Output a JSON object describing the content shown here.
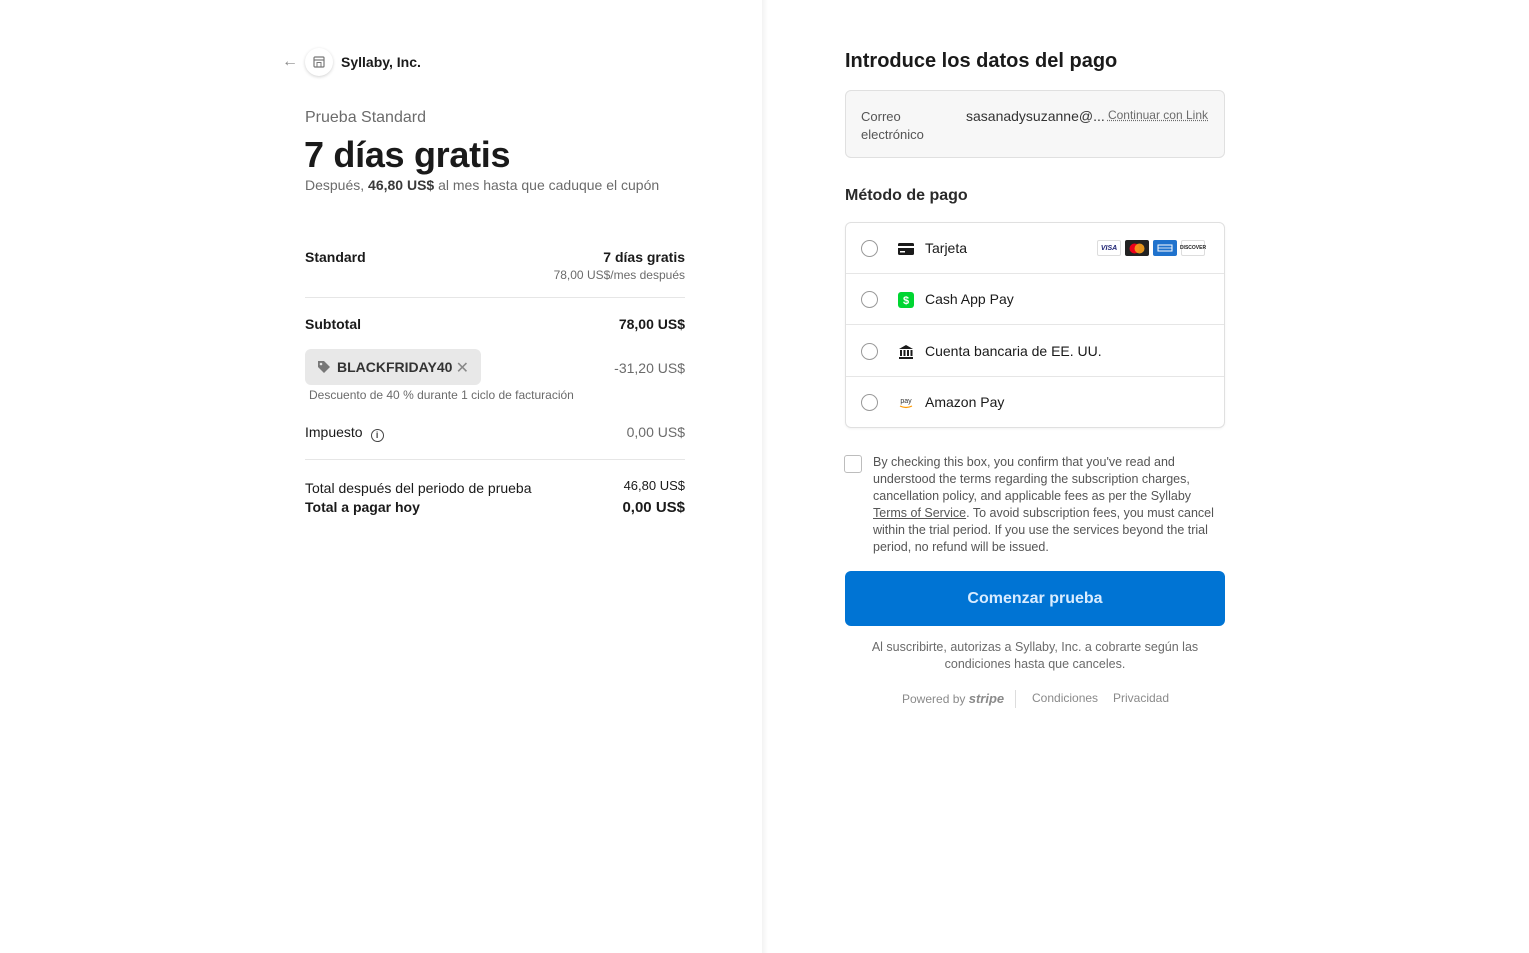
{
  "merchant": {
    "name": "Syllaby, Inc."
  },
  "summary": {
    "product_name": "Prueba Standard",
    "headline": "7 días gratis",
    "subline_prefix": "Después, ",
    "subline_amount": "46,80 US$",
    "subline_suffix": " al mes hasta que caduque el cupón"
  },
  "line_item": {
    "name": "Standard",
    "price": "7 días gratis",
    "price_after": "78,00 US$/mes después"
  },
  "subtotal": {
    "label": "Subtotal",
    "value": "78,00 US$"
  },
  "coupon": {
    "code": "BLACKFRIDAY40",
    "discount": "-31,20 US$",
    "description": "Descuento de 40 % durante 1 ciclo de facturación"
  },
  "tax": {
    "label": "Impuesto",
    "value": "0,00 US$"
  },
  "total_after_trial": {
    "label": "Total después del periodo de prueba",
    "value": "46,80 US$"
  },
  "total_today": {
    "label": "Total a pagar hoy",
    "value": "0,00 US$"
  },
  "payment": {
    "title": "Introduce los datos del pago",
    "email_label": "Correo electrónico",
    "email_value": "sasanadysuzanne@...",
    "link_button": "Continuar con Link",
    "method_title": "Método de pago",
    "methods": [
      {
        "label": "Tarjeta",
        "icon": "card-icon"
      },
      {
        "label": "Cash App Pay",
        "icon": "cash-app-icon"
      },
      {
        "label": "Cuenta bancaria de EE. UU.",
        "icon": "bank-icon"
      },
      {
        "label": "Amazon Pay",
        "icon": "amazon-pay-icon"
      }
    ],
    "card_brands": [
      "VISA",
      "Mastercard",
      "AMEX",
      "DISCOVER"
    ]
  },
  "terms": {
    "text_before": "By checking this box, you confirm that you've read and understood the terms regarding the subscription charges, cancellation policy, and applicable fees as per the Syllaby ",
    "link": "Terms of Service",
    "text_after": ". To avoid subscription fees, you must cancel within the trial period. If you use the services beyond the trial period, no refund will be issued."
  },
  "cta": {
    "label": "Comenzar prueba"
  },
  "legal": "Al suscribirte, autorizas a Syllaby, Inc. a cobrarte según las condiciones hasta que canceles.",
  "footer": {
    "powered_by": "Powered by",
    "brand": "stripe",
    "terms": "Condiciones",
    "privacy": "Privacidad"
  },
  "colors": {
    "primary": "#0074d4",
    "cash_app": "#00d632"
  }
}
